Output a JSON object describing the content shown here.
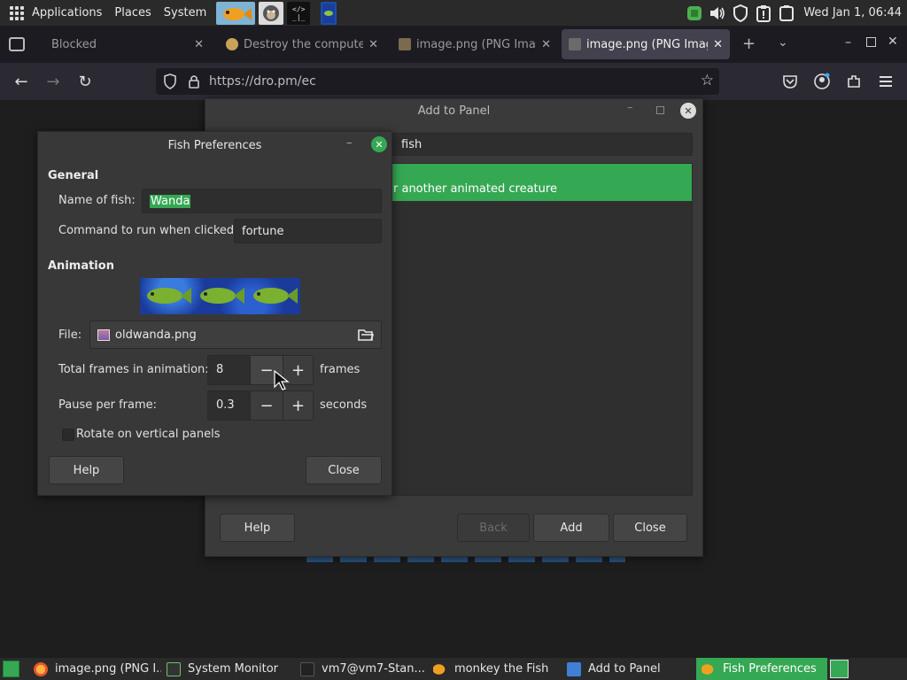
{
  "top_panel": {
    "menus": [
      "Applications",
      "Places",
      "System"
    ],
    "clock": "Wed Jan  1, 06:44"
  },
  "browser": {
    "tabs": [
      {
        "title": "Blocked",
        "active": false
      },
      {
        "title": "Destroy the computer",
        "active": false
      },
      {
        "title": "image.png (PNG Image",
        "active": false
      },
      {
        "title": "image.png (PNG Image",
        "active": true
      }
    ],
    "url": "https://dro.pm/ec"
  },
  "add_to_panel": {
    "title": "Add to Panel",
    "search_value": "fish",
    "selected_item_text": "r another animated creature",
    "buttons": {
      "help": "Help",
      "back": "Back",
      "add": "Add",
      "close": "Close"
    }
  },
  "fish_prefs": {
    "title": "Fish Preferences",
    "general_title": "General",
    "name_label": "Name of fish:",
    "name_value": "Wanda",
    "command_label": "Command to run when clicked:",
    "command_value": "fortune",
    "animation_title": "Animation",
    "file_label": "File:",
    "file_value": "oldwanda.png",
    "frames_label": "Total frames in animation:",
    "frames_value": "8",
    "frames_unit": "frames",
    "pause_label": "Pause per frame:",
    "pause_value": "0.3",
    "pause_unit": "seconds",
    "rotate_label": "Rotate on vertical panels",
    "rotate_checked": false,
    "help_label": "Help",
    "close_label": "Close"
  },
  "taskbar": {
    "tasks": [
      {
        "label": "image.png (PNG I...",
        "active": false
      },
      {
        "label": "System Monitor",
        "active": false
      },
      {
        "label": "vm7@vm7-Stan...",
        "active": false
      },
      {
        "label": "monkey the Fish",
        "active": false
      },
      {
        "label": "Add to Panel",
        "active": false
      },
      {
        "label": "Fish Preferences",
        "active": true
      }
    ]
  },
  "colors": {
    "accent_green": "#35a853",
    "dialog_bg": "#383838",
    "panel_bg": "#2a2a2a",
    "browser_tab_active": "#42414d"
  }
}
